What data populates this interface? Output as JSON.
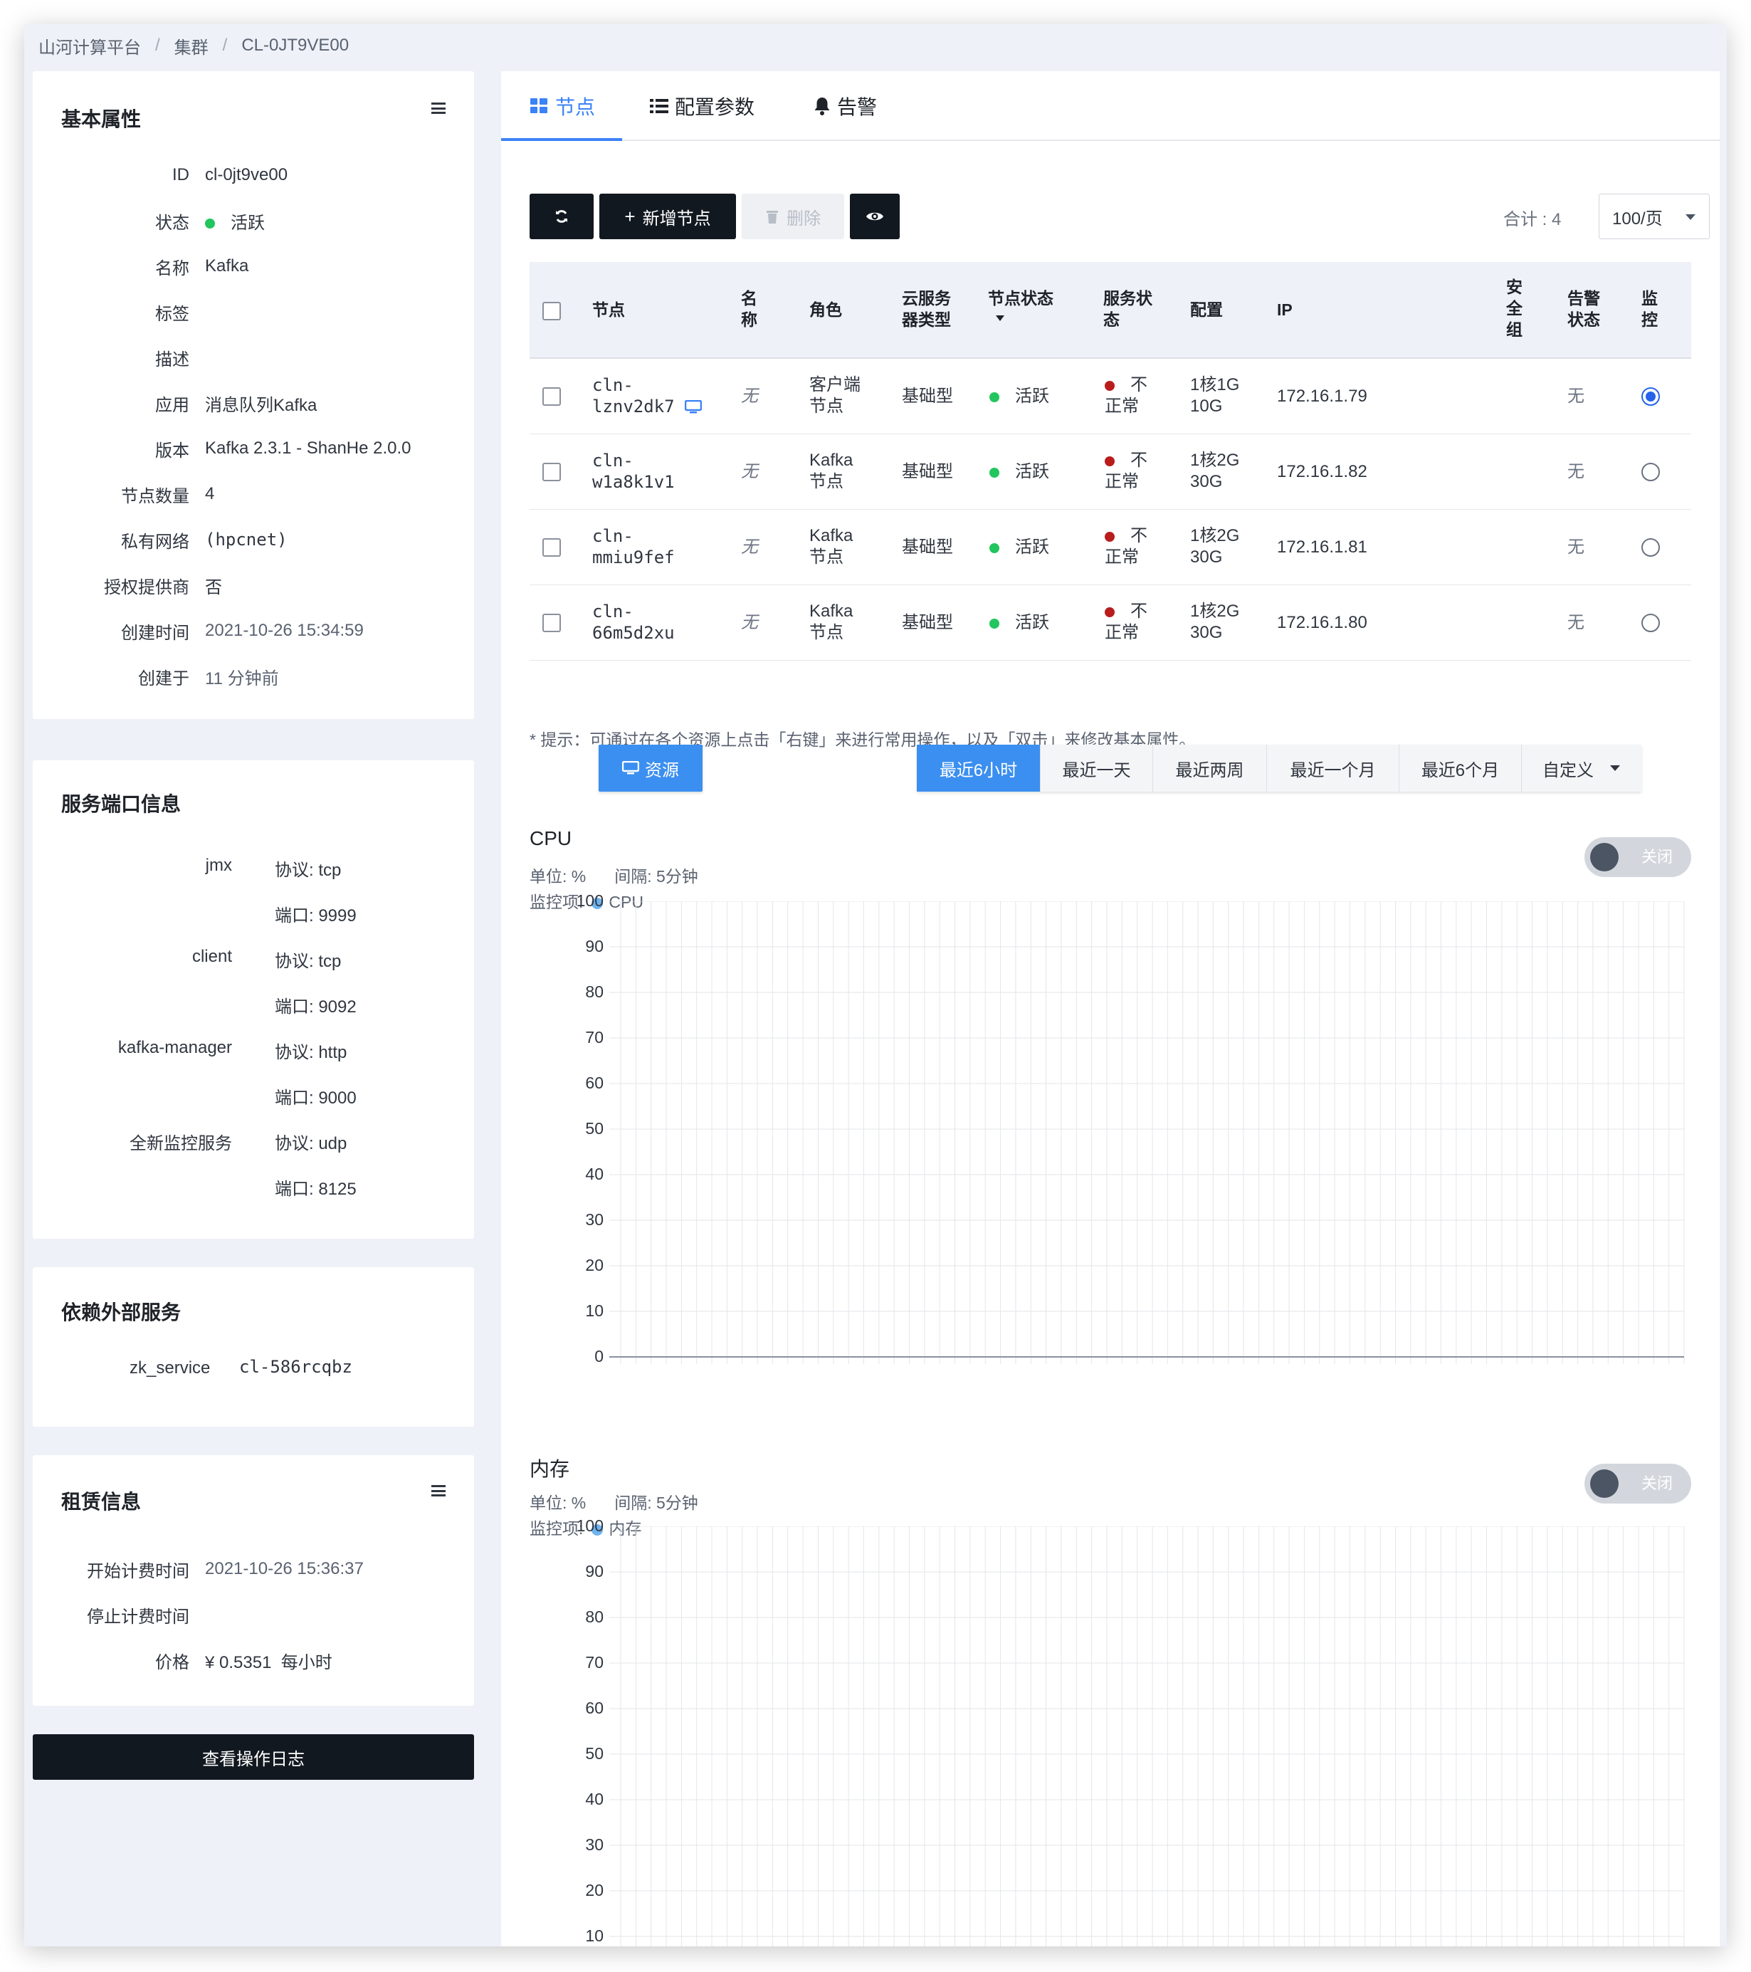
{
  "breadcrumb": [
    "山河计算平台",
    "集群",
    "CL-0JT9VE00"
  ],
  "basic": {
    "title": "基本属性",
    "fields": [
      {
        "key": "ID",
        "value": "cl-0jt9ve00"
      },
      {
        "key": "状态",
        "value": "活跃"
      },
      {
        "key": "名称",
        "value": "Kafka"
      },
      {
        "key": "标签",
        "value": ""
      },
      {
        "key": "描述",
        "value": ""
      },
      {
        "key": "应用",
        "value": "消息队列Kafka"
      },
      {
        "key": "版本",
        "value": "Kafka 2.3.1 - ShanHe 2.0.0"
      },
      {
        "key": "节点数量",
        "value": "4"
      },
      {
        "key": "私有网络",
        "value": "(hpcnet)"
      },
      {
        "key": "授权提供商",
        "value": "否"
      },
      {
        "key": "创建时间",
        "value": "2021-10-26 15:34:59"
      },
      {
        "key": "创建于",
        "value": "11 分钟前"
      }
    ]
  },
  "ports": {
    "title": "服务端口信息",
    "services": [
      {
        "name": "jmx",
        "protocol": "协议: tcp",
        "port": "端口: 9999"
      },
      {
        "name": "client",
        "protocol": "协议: tcp",
        "port": "端口: 9092"
      },
      {
        "name": "kafka-manager",
        "protocol": "协议: http",
        "port": "端口: 9000"
      },
      {
        "name": "全新监控服务",
        "protocol": "协议: udp",
        "port": "端口: 8125"
      }
    ]
  },
  "deps": {
    "title": "依赖外部服务",
    "key": "zk_service",
    "value": "cl-586rcqbz"
  },
  "lease": {
    "title": "租赁信息",
    "start_key": "开始计费时间",
    "start_value": "2021-10-26 15:36:37",
    "stop_key": "停止计费时间",
    "stop_value": "",
    "price_key": "价格",
    "price_value": "¥ 0.5351  每小时"
  },
  "oplog_button": "查看操作日志",
  "tabs": [
    "节点",
    "配置参数",
    "告警"
  ],
  "toolbar": {
    "add": "新增节点",
    "delete": "删除",
    "total": "合计 : 4",
    "page_size": "100/页"
  },
  "table": {
    "headers": {
      "node": "节点",
      "name": [
        "名",
        "称"
      ],
      "role": "角色",
      "type": [
        "云服务",
        "器类型"
      ],
      "node_status": "节点状态",
      "svc_status": [
        "服务状",
        "态"
      ],
      "config": "配置",
      "ip": "IP",
      "secgroup": [
        "安",
        "全",
        "组"
      ],
      "alarm": [
        "告警",
        "状态"
      ],
      "monitor": [
        "监",
        "控"
      ]
    },
    "rows": [
      {
        "id1": "cln-",
        "id2": "lznv2dk7",
        "name": "无",
        "role1": "客户端",
        "role2": "节点",
        "type": "基础型",
        "status": "活跃",
        "svc1": "不",
        "svc2": "正常",
        "cfg1": "1核1G",
        "cfg2": "10G",
        "ip": "172.16.1.79",
        "alarm": "无",
        "monitored": true
      },
      {
        "id1": "cln-",
        "id2": "w1a8k1v1",
        "name": "无",
        "role1": "Kafka",
        "role2": "节点",
        "type": "基础型",
        "status": "活跃",
        "svc1": "不",
        "svc2": "正常",
        "cfg1": "1核2G",
        "cfg2": "30G",
        "ip": "172.16.1.82",
        "alarm": "无",
        "monitored": false
      },
      {
        "id1": "cln-",
        "id2": "mmiu9fef",
        "name": "无",
        "role1": "Kafka",
        "role2": "节点",
        "type": "基础型",
        "status": "活跃",
        "svc1": "不",
        "svc2": "正常",
        "cfg1": "1核2G",
        "cfg2": "30G",
        "ip": "172.16.1.81",
        "alarm": "无",
        "monitored": false
      },
      {
        "id1": "cln-",
        "id2": "66m5d2xu",
        "name": "无",
        "role1": "Kafka",
        "role2": "节点",
        "type": "基础型",
        "status": "活跃",
        "svc1": "不",
        "svc2": "正常",
        "cfg1": "1核2G",
        "cfg2": "30G",
        "ip": "172.16.1.80",
        "alarm": "无",
        "monitored": false
      }
    ]
  },
  "hint": "* 提示：可通过在各个资源上点击「右键」来进行常用操作，以及「双击」来修改基本属性。",
  "resource_button": "资源",
  "ranges": [
    "最近6小时",
    "最近一天",
    "最近两周",
    "最近一个月",
    "最近6个月",
    "自定义"
  ],
  "charts": [
    {
      "title": "CPU",
      "unit": "单位: %",
      "interval": "间隔: 5分钟",
      "item_label": "监控项:",
      "item": "CPU",
      "toggle": "关闭",
      "yticks": [
        "100",
        "90",
        "80",
        "70",
        "60",
        "50",
        "40",
        "30",
        "20",
        "10",
        "0"
      ]
    },
    {
      "title": "内存",
      "unit": "单位: %",
      "interval": "间隔: 5分钟",
      "item_label": "监控项:",
      "item": "内存",
      "toggle": "关闭",
      "yticks": [
        "100",
        "90",
        "80",
        "70",
        "60",
        "50",
        "40",
        "30",
        "20",
        "10"
      ]
    }
  ],
  "colors": {
    "accent": "#3b82f6",
    "active": "#22c55e",
    "error": "#b91c1c",
    "dark": "#121820"
  }
}
